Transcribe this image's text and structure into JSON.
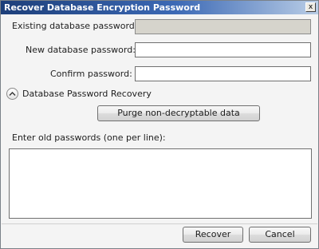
{
  "window": {
    "title": "Recover Database Encryption Password",
    "close_glyph": "x"
  },
  "form": {
    "existing_label": "Existing database password:",
    "existing_value": "",
    "new_label": "New database password:",
    "new_value": "",
    "confirm_label": "Confirm password:",
    "confirm_value": ""
  },
  "recovery": {
    "section_label": "Database Password Recovery",
    "purge_label": "Purge non-decryptable data",
    "old_passwords_label": "Enter old passwords (one per line):",
    "old_passwords_value": ""
  },
  "footer": {
    "recover_label": "Recover",
    "cancel_label": "Cancel"
  },
  "icons": {
    "close": "close-icon",
    "section_toggle": "chevron-up-icon"
  },
  "colors": {
    "title_bar_start": "#1d3f7a",
    "title_bar_end": "#b9cde6",
    "disabled_field": "#d6d4cc"
  }
}
